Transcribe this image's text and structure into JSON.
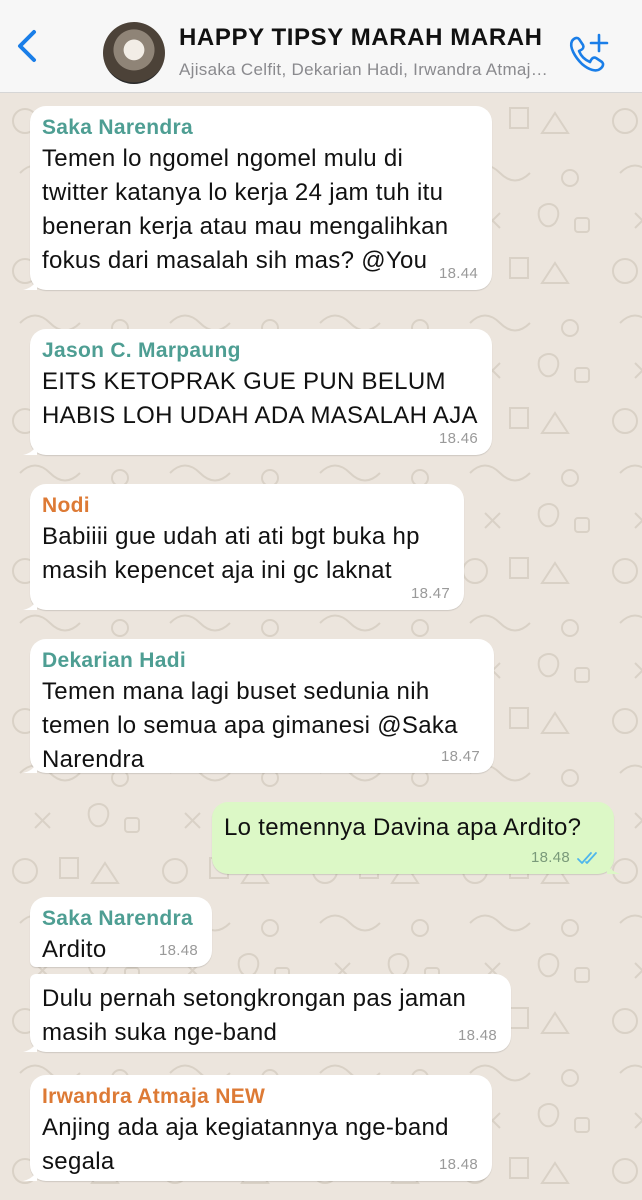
{
  "header": {
    "title": "HAPPY TIPSY MARAH MARAH",
    "subtitle": "Ajisaka Celfit, Dekarian Hadi, Irwandra Atmaja NEW",
    "icons": {
      "back": "chevron-left-icon",
      "call": "add-call-icon"
    }
  },
  "colors": {
    "accent": "#1a7ee8",
    "outgoing_bubble": "#dcf8c6",
    "incoming_bubble": "#ffffff",
    "read_ticks": "#4fb6ec",
    "sender_saka": "#4e9e93",
    "sender_jason": "#4e9e93",
    "sender_nodi": "#dd7a35",
    "sender_dekarian": "#4e9e93",
    "sender_irwandra": "#dd7a35"
  },
  "messages": [
    {
      "sender": "Saka Narendra",
      "lines": [
        "Temen lo ngomel ngomel mulu di",
        "twitter katanya lo kerja 24 jam tuh itu",
        "beneran kerja atau mau mengalihkan",
        "fokus dari masalah sih mas? @You"
      ],
      "time": "18.44"
    },
    {
      "sender": "Jason C. Marpaung",
      "lines": [
        "EITS KETOPRAK GUE PUN BELUM",
        "HABIS LOH UDAH ADA MASALAH AJA"
      ],
      "time": "18.46"
    },
    {
      "sender": "Nodi",
      "lines": [
        "Babiiii gue udah ati ati bgt buka hp",
        "masih kepencet aja ini gc laknat"
      ],
      "time": "18.47"
    },
    {
      "sender": "Dekarian Hadi",
      "lines": [
        "Temen mana lagi buset sedunia nih",
        "temen lo semua apa gimanesi @Saka",
        "Narendra"
      ],
      "time": "18.47"
    },
    {
      "sender": "",
      "lines": [
        "Lo temennya Davina apa Ardito?"
      ],
      "time": "18.48",
      "status": "read"
    },
    {
      "sender": "Saka Narendra",
      "lines": [
        "Ardito"
      ],
      "time": "18.48"
    },
    {
      "sender": "",
      "lines": [
        "Dulu pernah setongkrongan pas jaman",
        "masih suka nge-band"
      ],
      "time": "18.48"
    },
    {
      "sender": "Irwandra Atmaja NEW",
      "lines": [
        "Anjing ada aja kegiatannya nge-band",
        "segala"
      ],
      "time": "18.48"
    }
  ]
}
